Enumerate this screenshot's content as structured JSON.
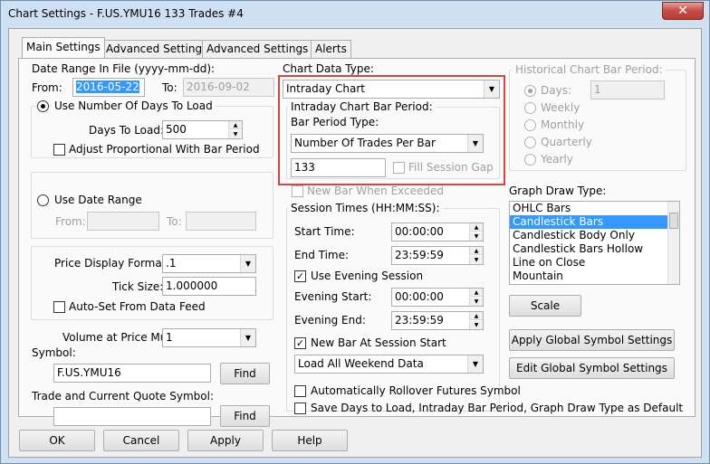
{
  "window": {
    "title": "Chart Settings - F.US.YMU16  133 Trades  #4",
    "close_label": "✕"
  },
  "tabs": [
    "Main Settings",
    "Advanced Settings",
    "Advanced Settings 2",
    "Alerts"
  ],
  "date_range": {
    "label": "Date Range In File (yyyy-mm-dd):",
    "from_label": "From:",
    "from_value": "2016-05-22",
    "to_label": "To:",
    "to_value": "2016-09-02"
  },
  "days_group": {
    "radio_label": "Use Number Of Days To Load",
    "days_label": "Days To Load:",
    "days_value": "500",
    "adjust_label": "Adjust Proportional With Bar Period"
  },
  "date_range_group": {
    "radio_label": "Use Date Range",
    "from_label": "From:",
    "to_label": "To:"
  },
  "price_group": {
    "format_label": "Price Display Format:",
    "format_value": ".1",
    "tick_label": "Tick Size:",
    "tick_value": "1.000000",
    "autoset_label": "Auto-Set From Data Feed"
  },
  "volume": {
    "label": "Volume at Price Mult.:",
    "value": "1"
  },
  "symbol": {
    "label": "Symbol:",
    "value": "F.US.YMU16",
    "find_label": "Find"
  },
  "trade_symbol": {
    "label": "Trade and Current Quote Symbol:",
    "value": "",
    "find_label": "Find"
  },
  "chart_data_type": {
    "label": "Chart Data Type:",
    "value": "Intraday Chart"
  },
  "intraday_period": {
    "group_label": "Intraday Chart Bar Period:",
    "type_label": "Bar Period Type:",
    "type_value": "Number Of Trades Per Bar",
    "value": "133",
    "fill_gap_label": "Fill Session Gap",
    "new_bar_label": "New Bar When Exceeded"
  },
  "session": {
    "group_label": "Session Times (HH:MM:SS):",
    "start_label": "Start Time:",
    "start_value": "00:00:00",
    "end_label": "End Time:",
    "end_value": "23:59:59",
    "evening_label": "Use Evening Session",
    "evening_start_label": "Evening Start:",
    "evening_start_value": "00:00:00",
    "evening_end_label": "Evening End:",
    "evening_end_value": "23:59:59",
    "new_bar_label": "New Bar At Session Start",
    "weekend_value": "Load All Weekend Data"
  },
  "auto_rollover_label": "Automatically Rollover Futures Symbol",
  "save_default_label": "Save Days to Load, Intraday Bar Period, Graph Draw Type as Default",
  "historical": {
    "group_label": "Historical Chart Bar Period:",
    "days_label": "Days:",
    "days_value": "1",
    "weekly_label": "Weekly",
    "monthly_label": "Monthly",
    "quarterly_label": "Quarterly",
    "yearly_label": "Yearly"
  },
  "graph_draw": {
    "label": "Graph Draw Type:",
    "items": [
      "OHLC Bars",
      "Candlestick Bars",
      "Candlestick Body Only",
      "Candlestick Bars Hollow",
      "Line on Close",
      "Mountain"
    ],
    "selected": "Candlestick Bars"
  },
  "buttons": {
    "scale": "Scale",
    "apply_global": "Apply Global Symbol Settings",
    "edit_global": "Edit Global Symbol Settings",
    "ok": "OK",
    "cancel": "Cancel",
    "apply": "Apply",
    "help": "Help"
  },
  "colors": {
    "highlight": "#d9453a",
    "selection": "#3399ff"
  }
}
